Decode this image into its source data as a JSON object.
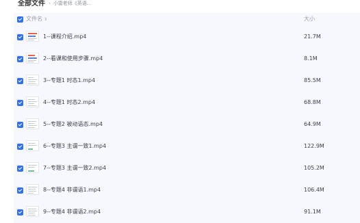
{
  "breadcrumb": {
    "root": "全部文件",
    "separator": "›",
    "current": "小雷老师《英语..."
  },
  "list_header": {
    "name_label": "文件名",
    "size_label": "大小"
  },
  "files": [
    {
      "name": "1--课程介绍.mp4",
      "size": "21.7M",
      "selected": true
    },
    {
      "name": "2--看课和使用步骤.mp4",
      "size": "8.1M",
      "selected": true
    },
    {
      "name": "3--专题1 时态1.mp4",
      "size": "85.5M",
      "selected": true
    },
    {
      "name": "4--专题1 时态2.mp4",
      "size": "68.8M",
      "selected": true
    },
    {
      "name": "5--专题2 被动语态.mp4",
      "size": "64.9M",
      "selected": true
    },
    {
      "name": "6--专题3 主谓一致1.mp4",
      "size": "122.9M",
      "selected": true
    },
    {
      "name": "7--专题3 主谓一致2.mp4",
      "size": "105.2M",
      "selected": true
    },
    {
      "name": "8--专题4 非谓语1.mp4",
      "size": "106.4M",
      "selected": true
    },
    {
      "name": "9--专题4 非谓语2.mp4",
      "size": "91.1M",
      "selected": true
    }
  ],
  "colors": {
    "accent": "#2f6ff0",
    "list_background": "#f6f8fd"
  }
}
